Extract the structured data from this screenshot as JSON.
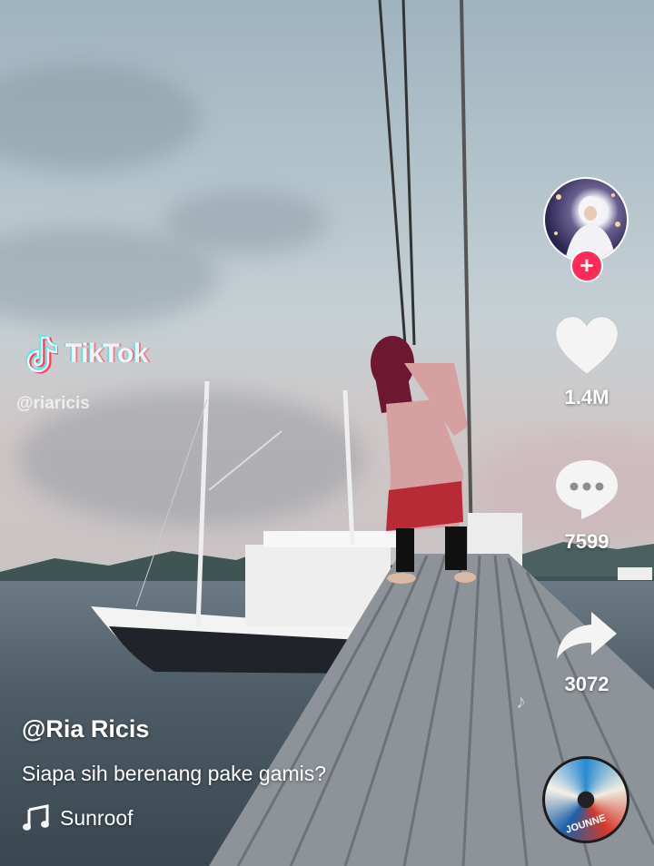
{
  "watermark": {
    "brand": "TikTok",
    "handle": "@riaricis"
  },
  "rail": {
    "likes": "1.4M",
    "comments": "7599",
    "shares": "3072"
  },
  "video": {
    "username": "@Ria Ricis",
    "caption": "Siapa sih berenang pake gamis?",
    "sound": "Sunroof"
  },
  "disc": {
    "label": "JOUNNE"
  },
  "colors": {
    "follow": "#fe2c55",
    "text": "#ffffff"
  },
  "icons": [
    "tiktok-logo-icon",
    "plus-icon",
    "heart-icon",
    "comment-icon",
    "share-icon",
    "music-note-icon",
    "music-disc-icon"
  ]
}
